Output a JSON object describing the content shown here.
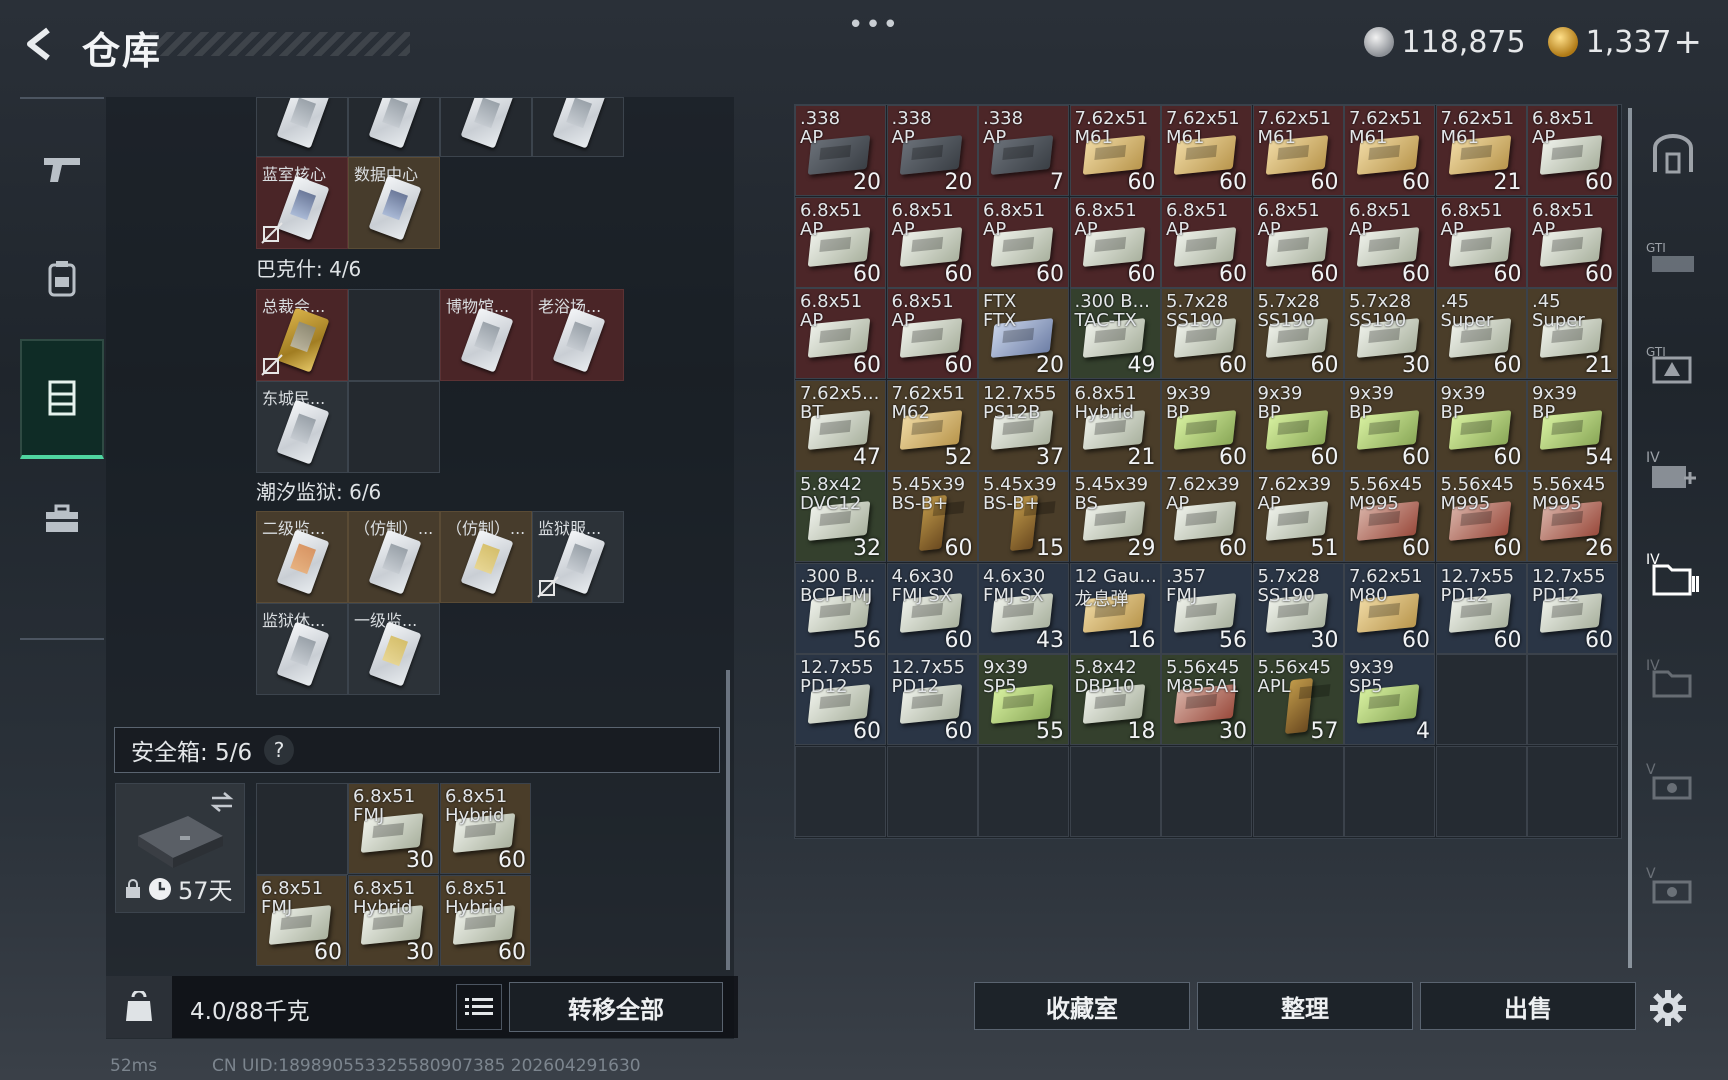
{
  "header": {
    "title": "仓库",
    "more": "•••",
    "currency_silver": "118,875",
    "currency_gold": "1,337",
    "add_label": "+"
  },
  "left_rail": {
    "items": [
      {
        "name": "weapons",
        "icon": "pistol-icon"
      },
      {
        "name": "gear",
        "icon": "backpack-icon"
      },
      {
        "name": "storage",
        "icon": "locker-icon",
        "active": true
      },
      {
        "name": "briefcase",
        "icon": "briefcase-icon"
      }
    ]
  },
  "stash": {
    "top_row_labels": [
      "",
      "",
      "",
      ""
    ],
    "row2": [
      "蓝室核心",
      "数据中心"
    ],
    "bakshi_header": "巴克什: 4/6",
    "bakshi": [
      "总裁会...",
      "",
      "博物馆...",
      "老浴场...",
      "东城民..."
    ],
    "prison_header": "潮汐监狱: 6/6",
    "prison": [
      "二级监...",
      "（仿制）...",
      "（仿制）...",
      "监狱服...",
      "监狱休...",
      "一级监..."
    ]
  },
  "safebox": {
    "label": "安全箱: 5/6",
    "help": "?",
    "days": "57天",
    "items": [
      {
        "l1": "6.8x51",
        "l2": "FMJ",
        "qty": "30"
      },
      {
        "l1": "6.8x51",
        "l2": "Hybrid",
        "qty": "60"
      },
      {
        "l1": "6.8x51",
        "l2": "FMJ",
        "qty": "60"
      },
      {
        "l1": "6.8x51",
        "l2": "Hybrid",
        "qty": "30"
      },
      {
        "l1": "6.8x51",
        "l2": "Hybrid",
        "qty": "60"
      }
    ]
  },
  "footer_left": {
    "weight": "4.0/88千克",
    "transfer_all": "转移全部"
  },
  "ammo_grid": [
    {
      "l1": ".338",
      "l2": "AP",
      "qty": "20",
      "bg": "red",
      "box": "gray"
    },
    {
      "l1": ".338",
      "l2": "AP",
      "qty": "20",
      "bg": "red",
      "box": "gray"
    },
    {
      "l1": ".338",
      "l2": "AP",
      "qty": "7",
      "bg": "red",
      "box": "gray"
    },
    {
      "l1": "7.62x51",
      "l2": "M61",
      "qty": "60",
      "bg": "red",
      "box": "tan"
    },
    {
      "l1": "7.62x51",
      "l2": "M61",
      "qty": "60",
      "bg": "red",
      "box": "tan"
    },
    {
      "l1": "7.62x51",
      "l2": "M61",
      "qty": "60",
      "bg": "red",
      "box": "tan"
    },
    {
      "l1": "7.62x51",
      "l2": "M61",
      "qty": "60",
      "bg": "red",
      "box": "tan"
    },
    {
      "l1": "7.62x51",
      "l2": "M61",
      "qty": "21",
      "bg": "red",
      "box": "tan"
    },
    {
      "l1": "6.8x51",
      "l2": "AP",
      "qty": "60",
      "bg": "red",
      "box": "white"
    },
    {
      "l1": "6.8x51",
      "l2": "AP",
      "qty": "60",
      "bg": "red",
      "box": "white"
    },
    {
      "l1": "6.8x51",
      "l2": "AP",
      "qty": "60",
      "bg": "red",
      "box": "white"
    },
    {
      "l1": "6.8x51",
      "l2": "AP",
      "qty": "60",
      "bg": "red",
      "box": "white"
    },
    {
      "l1": "6.8x51",
      "l2": "AP",
      "qty": "60",
      "bg": "red",
      "box": "white"
    },
    {
      "l1": "6.8x51",
      "l2": "AP",
      "qty": "60",
      "bg": "red",
      "box": "white"
    },
    {
      "l1": "6.8x51",
      "l2": "AP",
      "qty": "60",
      "bg": "red",
      "box": "white"
    },
    {
      "l1": "6.8x51",
      "l2": "AP",
      "qty": "60",
      "bg": "red",
      "box": "white"
    },
    {
      "l1": "6.8x51",
      "l2": "AP",
      "qty": "60",
      "bg": "red",
      "box": "white"
    },
    {
      "l1": "6.8x51",
      "l2": "AP",
      "qty": "60",
      "bg": "red",
      "box": "white"
    },
    {
      "l1": "6.8x51",
      "l2": "AP",
      "qty": "60",
      "bg": "red",
      "box": "white"
    },
    {
      "l1": "6.8x51",
      "l2": "AP",
      "qty": "60",
      "bg": "red",
      "box": "white"
    },
    {
      "l1": "FTX",
      "l2": "FTX",
      "qty": "20",
      "bg": "gold",
      "box": "blue"
    },
    {
      "l1": ".300 B...",
      "l2": "TAC-TX",
      "qty": "49",
      "bg": "green",
      "box": "white"
    },
    {
      "l1": "5.7x28",
      "l2": "SS190",
      "qty": "60",
      "bg": "gold",
      "box": "white"
    },
    {
      "l1": "5.7x28",
      "l2": "SS190",
      "qty": "60",
      "bg": "gold",
      "box": "white"
    },
    {
      "l1": "5.7x28",
      "l2": "SS190",
      "qty": "30",
      "bg": "gold",
      "box": "white"
    },
    {
      "l1": ".45",
      "l2": "Super",
      "qty": "60",
      "bg": "gold",
      "box": "white"
    },
    {
      "l1": ".45",
      "l2": "Super",
      "qty": "21",
      "bg": "gold",
      "box": "white"
    },
    {
      "l1": "7.62x5...",
      "l2": "BT",
      "qty": "47",
      "bg": "gold",
      "box": "white"
    },
    {
      "l1": "7.62x51",
      "l2": "M62",
      "qty": "52",
      "bg": "gold",
      "box": "tan"
    },
    {
      "l1": "12.7x55",
      "l2": "PS12B",
      "qty": "37",
      "bg": "gold",
      "box": "white"
    },
    {
      "l1": "6.8x51",
      "l2": "Hybrid",
      "qty": "21",
      "bg": "gold",
      "box": "white"
    },
    {
      "l1": "9x39",
      "l2": "BP",
      "qty": "60",
      "bg": "gold",
      "box": "lime"
    },
    {
      "l1": "9x39",
      "l2": "BP",
      "qty": "60",
      "bg": "gold",
      "box": "lime"
    },
    {
      "l1": "9x39",
      "l2": "BP",
      "qty": "60",
      "bg": "gold",
      "box": "lime"
    },
    {
      "l1": "9x39",
      "l2": "BP",
      "qty": "60",
      "bg": "gold",
      "box": "lime"
    },
    {
      "l1": "9x39",
      "l2": "BP",
      "qty": "54",
      "bg": "gold",
      "box": "lime"
    },
    {
      "l1": "5.8x42",
      "l2": "DVC12",
      "qty": "32",
      "bg": "green",
      "box": "white"
    },
    {
      "l1": "5.45x39",
      "l2": "BS-B+",
      "qty": "60",
      "bg": "gold",
      "box": "bullet"
    },
    {
      "l1": "5.45x39",
      "l2": "BS-B+",
      "qty": "15",
      "bg": "gold",
      "box": "bullet"
    },
    {
      "l1": "5.45x39",
      "l2": "BS",
      "qty": "29",
      "bg": "gold",
      "box": "white"
    },
    {
      "l1": "7.62x39",
      "l2": "AP",
      "qty": "60",
      "bg": "gold",
      "box": "white"
    },
    {
      "l1": "7.62x39",
      "l2": "AP",
      "qty": "51",
      "bg": "gold",
      "box": "white"
    },
    {
      "l1": "5.56x45",
      "l2": "M995",
      "qty": "60",
      "bg": "gold",
      "box": "red"
    },
    {
      "l1": "5.56x45",
      "l2": "M995",
      "qty": "60",
      "bg": "gold",
      "box": "red"
    },
    {
      "l1": "5.56x45",
      "l2": "M995",
      "qty": "26",
      "bg": "gold",
      "box": "red"
    },
    {
      "l1": ".300 B...",
      "l2": "BCP FMJ",
      "qty": "56",
      "bg": "blue",
      "box": "white"
    },
    {
      "l1": "4.6x30",
      "l2": "FMJ SX",
      "qty": "60",
      "bg": "blue",
      "box": "white"
    },
    {
      "l1": "4.6x30",
      "l2": "FMJ SX",
      "qty": "43",
      "bg": "blue",
      "box": "white"
    },
    {
      "l1": "12 Gau...",
      "l2": "龙息弹",
      "qty": "16",
      "bg": "blue",
      "box": "tan"
    },
    {
      "l1": ".357",
      "l2": "FMJ",
      "qty": "56",
      "bg": "blue",
      "box": "white"
    },
    {
      "l1": "5.7x28",
      "l2": "SS190",
      "qty": "30",
      "bg": "blue",
      "box": "white"
    },
    {
      "l1": "7.62x51",
      "l2": "M80",
      "qty": "60",
      "bg": "blue",
      "box": "tan"
    },
    {
      "l1": "12.7x55",
      "l2": "PD12",
      "qty": "60",
      "bg": "blue",
      "box": "white"
    },
    {
      "l1": "12.7x55",
      "l2": "PD12",
      "qty": "60",
      "bg": "blue",
      "box": "white"
    },
    {
      "l1": "12.7x55",
      "l2": "PD12",
      "qty": "60",
      "bg": "blue",
      "box": "white"
    },
    {
      "l1": "12.7x55",
      "l2": "PD12",
      "qty": "60",
      "bg": "blue",
      "box": "white"
    },
    {
      "l1": "9x39",
      "l2": "SP5",
      "qty": "55",
      "bg": "green",
      "box": "lime"
    },
    {
      "l1": "5.8x42",
      "l2": "DBP10",
      "qty": "18",
      "bg": "green",
      "box": "white"
    },
    {
      "l1": "5.56x45",
      "l2": "M855A1",
      "qty": "30",
      "bg": "green",
      "box": "red"
    },
    {
      "l1": "5.56x45",
      "l2": "APL",
      "qty": "57",
      "bg": "green",
      "box": "bullet"
    },
    {
      "l1": "9x39",
      "l2": "SP5",
      "qty": "4",
      "bg": "blue",
      "box": "lime"
    }
  ],
  "right_rail": {
    "items": [
      "home-icon",
      "gti-icon",
      "gti-alert-icon",
      "iv-plus-icon",
      "iv-folder-icon",
      "iv-dim-icon",
      "v-icon",
      "v-dim-icon"
    ]
  },
  "footer_right": {
    "collection": "收藏室",
    "sort": "整理",
    "sell": "出售"
  },
  "status": {
    "ping": "52ms",
    "uid": "CN UID:1898905533255809073​85 202604291630"
  },
  "colors": {
    "accent_green": "#4fd6a0",
    "cell_red": "#4c2628",
    "cell_gold": "#4a3d29",
    "cell_blue": "#2a3545"
  }
}
